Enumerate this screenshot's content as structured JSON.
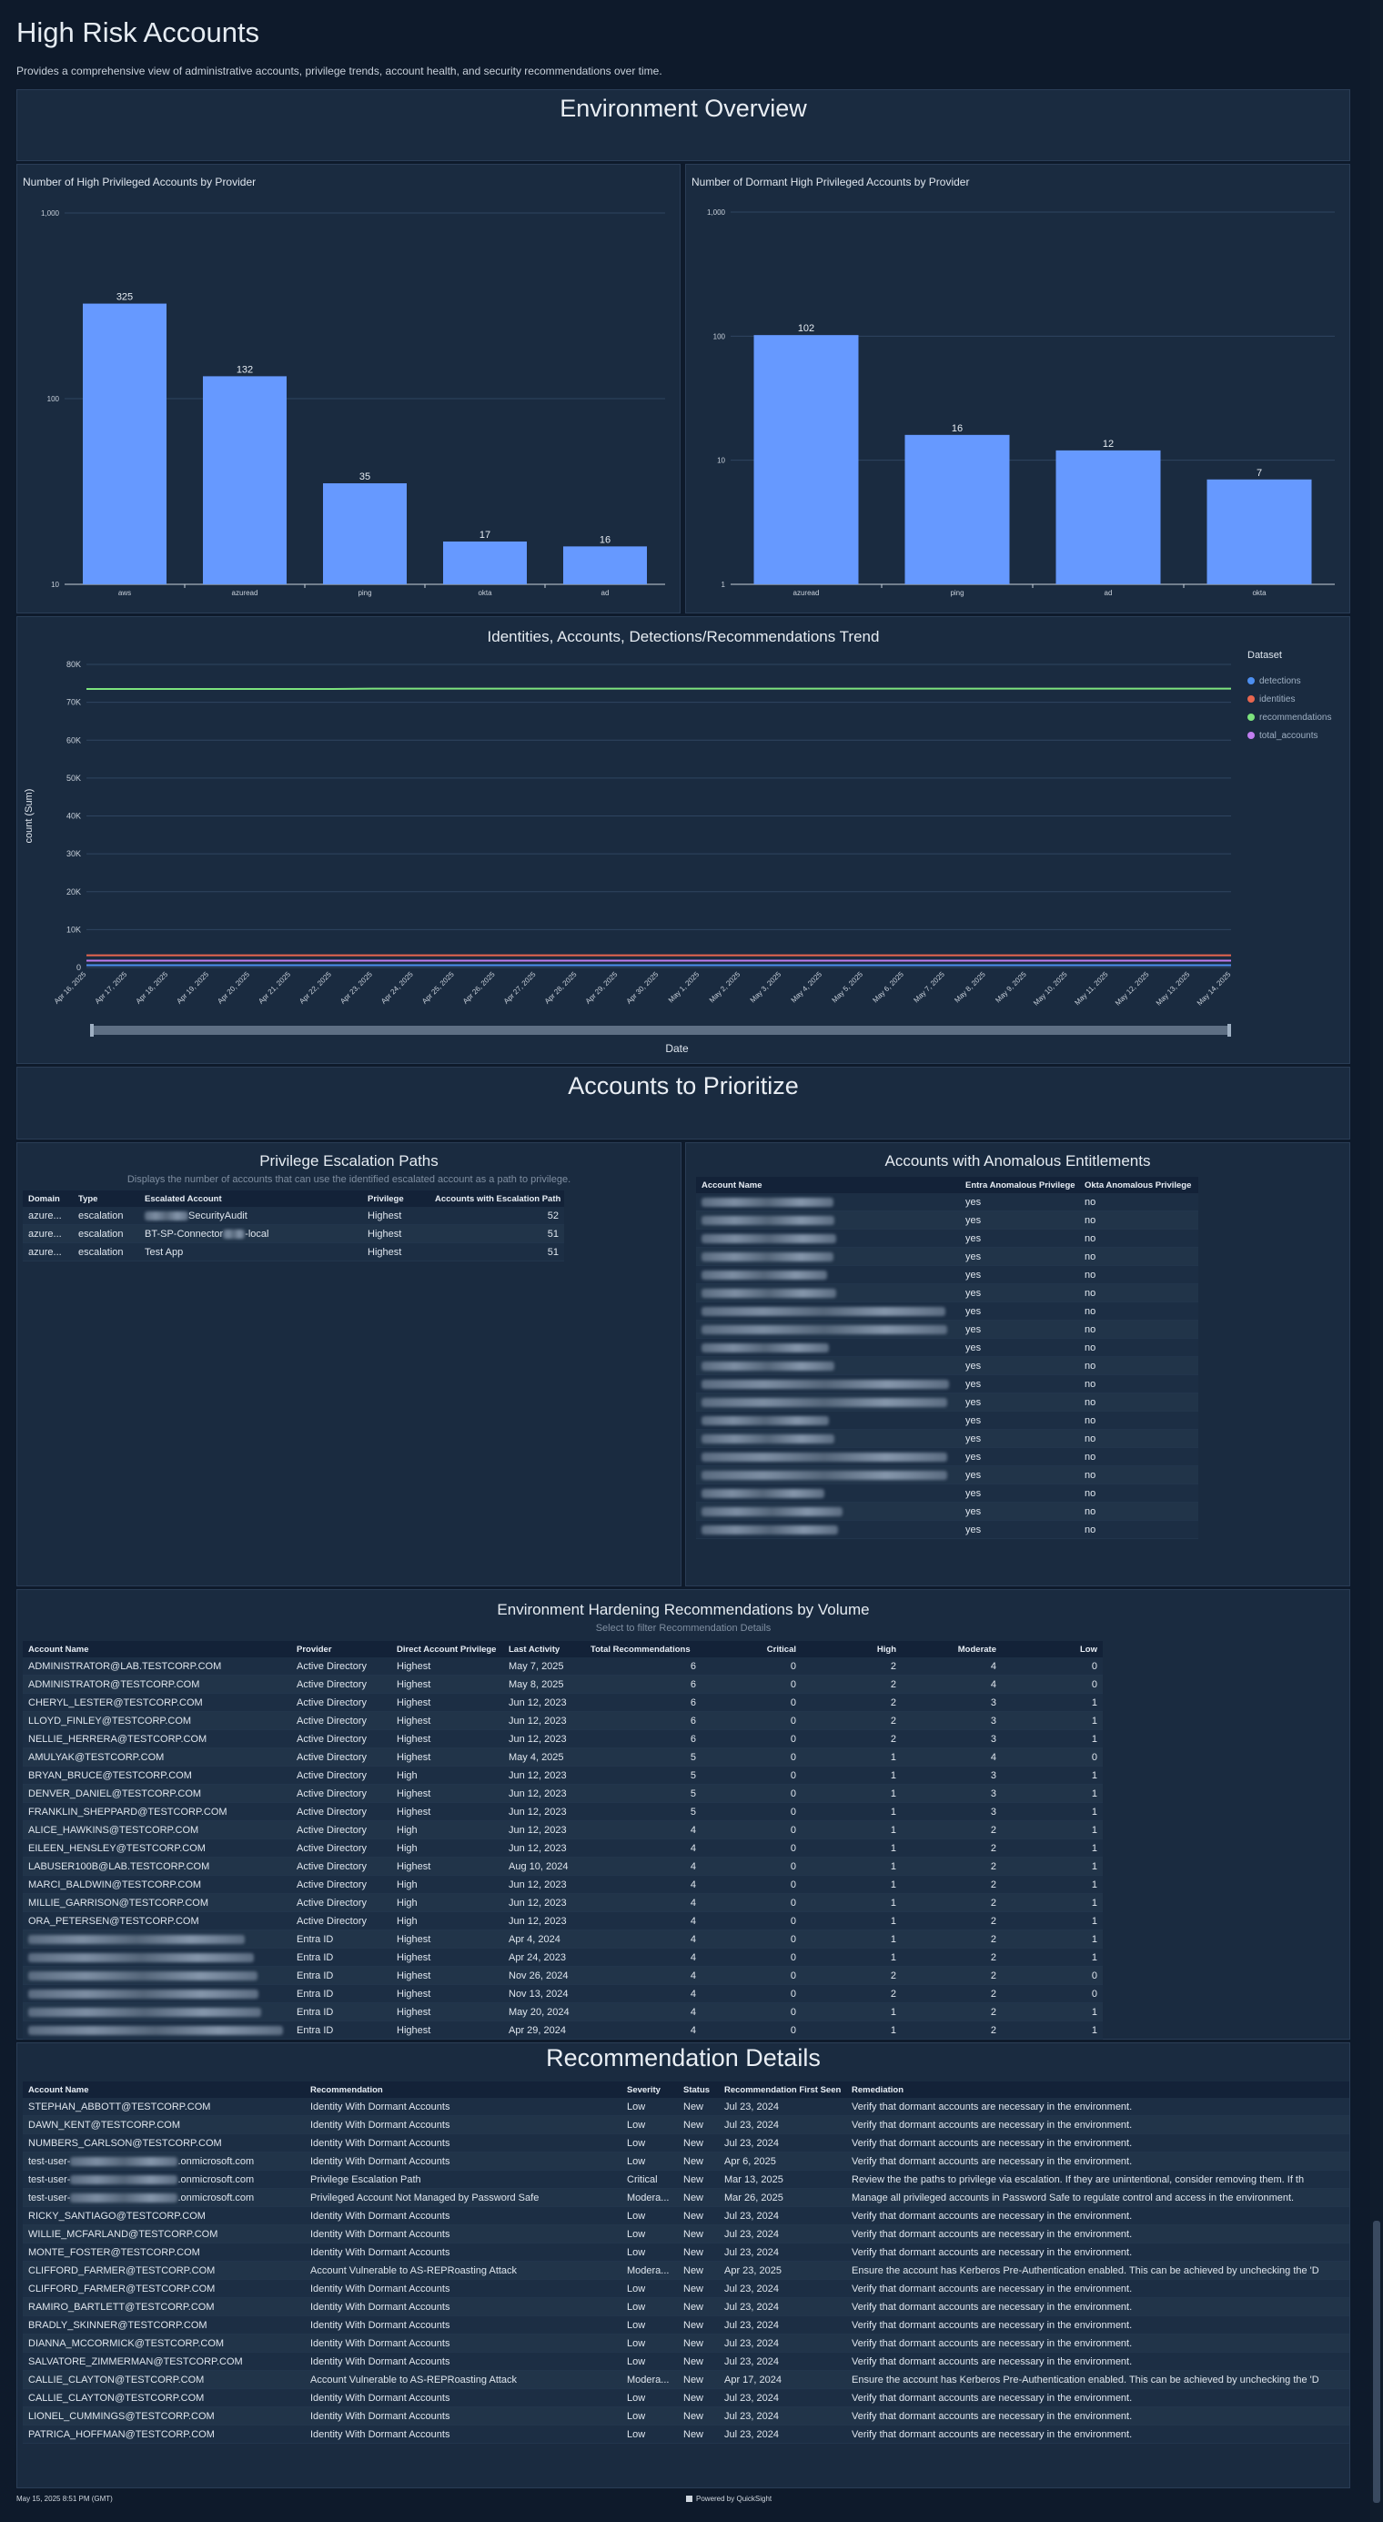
{
  "page": {
    "title": "High Risk Accounts",
    "description": "Provides a comprehensive view of administrative accounts, privilege trends, account health, and security recommendations over time."
  },
  "sections": {
    "env_overview": "Environment Overview",
    "accounts_to_prioritize": "Accounts to Prioritize",
    "recommendation_details": "Recommendation Details"
  },
  "charts": {
    "high_priv": {
      "title": "Number of High Privileged Accounts by Provider"
    },
    "dormant": {
      "title": "Number of Dormant High Privileged Accounts by Provider"
    },
    "trend": {
      "title": "Identities, Accounts, Detections/Recommendations Trend",
      "xlabel": "Date",
      "ylabel": "count (Sum)",
      "legend_title": "Dataset"
    }
  },
  "chart_data": [
    {
      "type": "bar",
      "title": "Number of High Privileged Accounts by Provider",
      "scale": "log",
      "ylim": [
        10,
        1000
      ],
      "yticks": [
        "10",
        "100",
        "1,000"
      ],
      "categories": [
        "aws",
        "azuread",
        "ping",
        "okta",
        "ad"
      ],
      "values": [
        325,
        132,
        35,
        17,
        16
      ],
      "color": "#6699ff"
    },
    {
      "type": "bar",
      "title": "Number of Dormant High Privileged Accounts by Provider",
      "scale": "log",
      "ylim": [
        1,
        1000
      ],
      "yticks": [
        "1",
        "10",
        "100",
        "1,000"
      ],
      "categories": [
        "azuread",
        "ping",
        "ad",
        "okta"
      ],
      "values": [
        102,
        16,
        12,
        7
      ],
      "color": "#6699ff"
    },
    {
      "type": "line",
      "title": "Identities, Accounts, Detections/Recommendations Trend",
      "xlabel": "Date",
      "ylabel": "count (Sum)",
      "ylim": [
        0,
        80000
      ],
      "yticks": [
        "0",
        "10K",
        "20K",
        "30K",
        "40K",
        "50K",
        "60K",
        "70K",
        "80K"
      ],
      "x": [
        "Apr 16, 2025",
        "Apr 17, 2025",
        "Apr 18, 2025",
        "Apr 19, 2025",
        "Apr 20, 2025",
        "Apr 21, 2025",
        "Apr 22, 2025",
        "Apr 23, 2025",
        "Apr 24, 2025",
        "Apr 25, 2025",
        "Apr 26, 2025",
        "Apr 27, 2025",
        "Apr 28, 2025",
        "Apr 29, 2025",
        "Apr 30, 2025",
        "May 1, 2025",
        "May 2, 2025",
        "May 3, 2025",
        "May 4, 2025",
        "May 5, 2025",
        "May 6, 2025",
        "May 7, 2025",
        "May 8, 2025",
        "May 9, 2025",
        "May 10, 2025",
        "May 11, 2025",
        "May 12, 2025",
        "May 13, 2025",
        "May 14, 2025"
      ],
      "series": [
        {
          "name": "detections",
          "color": "#4d8ff0",
          "values": [
            600,
            600,
            600,
            600,
            600,
            600,
            600,
            600,
            600,
            600,
            600,
            600,
            600,
            600,
            600,
            600,
            600,
            600,
            600,
            600,
            600,
            600,
            600,
            600,
            600,
            600,
            600,
            600,
            600
          ]
        },
        {
          "name": "identities",
          "color": "#e8664f",
          "values": [
            3200,
            3200,
            3200,
            3200,
            3200,
            3200,
            3200,
            3200,
            3200,
            3200,
            3200,
            3200,
            3200,
            3200,
            3200,
            3200,
            3200,
            3200,
            3200,
            3200,
            3200,
            3200,
            3200,
            3200,
            3200,
            3200,
            3200,
            3200,
            3200
          ]
        },
        {
          "name": "recommendations",
          "color": "#7de37d",
          "values": [
            73500,
            73500,
            73500,
            73500,
            73500,
            73500,
            73500,
            73600,
            73600,
            73600,
            73600,
            73600,
            73600,
            73600,
            73600,
            73600,
            73600,
            73600,
            73600,
            73600,
            73600,
            73600,
            73600,
            73600,
            73600,
            73600,
            73600,
            73600,
            73600
          ]
        },
        {
          "name": "total_accounts",
          "color": "#c17ef0",
          "values": [
            1800,
            1800,
            1800,
            1800,
            1800,
            1800,
            1800,
            1800,
            1800,
            1800,
            1800,
            1800,
            1800,
            1800,
            1800,
            1800,
            1800,
            1800,
            1800,
            1800,
            1800,
            1800,
            1800,
            1800,
            1800,
            1800,
            1800,
            1800,
            1800
          ]
        }
      ],
      "legend": "right"
    }
  ],
  "escalation": {
    "title": "Privilege Escalation Paths",
    "subtitle": "Displays the number of accounts that can use the identified escalated account as a path to privilege.",
    "headers": [
      "Domain",
      "Type",
      "Escalated Account",
      "Privilege",
      "Accounts with Escalation Path"
    ],
    "rows": [
      {
        "domain": "azure...",
        "type": "escalation",
        "account_suffix": "SecurityAudit",
        "privilege": "Highest",
        "count": "52"
      },
      {
        "domain": "azure...",
        "type": "escalation",
        "account_prefix": "BT-SP-Connector",
        "account_suffix": "-local",
        "privilege": "Highest",
        "count": "51"
      },
      {
        "domain": "azure...",
        "type": "escalation",
        "account": "Test App",
        "privilege": "Highest",
        "count": "51"
      }
    ]
  },
  "anomalous": {
    "title": "Accounts with Anomalous Entitlements",
    "headers": [
      "Account Name",
      "Entra Anomalous Privilege",
      "Okta Anomalous Privilege"
    ],
    "rows": [
      {
        "entra": "yes",
        "okta": "no"
      },
      {
        "entra": "yes",
        "okta": "no"
      },
      {
        "entra": "yes",
        "okta": "no"
      },
      {
        "entra": "yes",
        "okta": "no"
      },
      {
        "entra": "yes",
        "okta": "no"
      },
      {
        "entra": "yes",
        "okta": "no"
      },
      {
        "entra": "yes",
        "okta": "no"
      },
      {
        "entra": "yes",
        "okta": "no"
      },
      {
        "entra": "yes",
        "okta": "no"
      },
      {
        "entra": "yes",
        "okta": "no"
      },
      {
        "entra": "yes",
        "okta": "no"
      },
      {
        "entra": "yes",
        "okta": "no"
      },
      {
        "entra": "yes",
        "okta": "no"
      },
      {
        "entra": "yes",
        "okta": "no"
      },
      {
        "entra": "yes",
        "okta": "no"
      },
      {
        "entra": "yes",
        "okta": "no"
      },
      {
        "entra": "yes",
        "okta": "no"
      },
      {
        "entra": "yes",
        "okta": "no"
      },
      {
        "entra": "yes",
        "okta": "no"
      }
    ]
  },
  "hardening": {
    "title": "Environment Hardening Recommendations by Volume",
    "subtitle": "Select to filter Recommendation Details",
    "headers": [
      "Account Name",
      "Provider",
      "Direct Account Privilege",
      "Last Activity",
      "Total Recommendations",
      "Critical",
      "High",
      "Moderate",
      "Low"
    ],
    "rows": [
      {
        "name": "ADMINISTRATOR@LAB.TESTCORP.COM",
        "provider": "Active Directory",
        "priv": "Highest",
        "last": "May 7, 2025",
        "total": "6",
        "critical": "0",
        "high": "2",
        "moderate": "4",
        "low": "0"
      },
      {
        "name": "ADMINISTRATOR@TESTCORP.COM",
        "provider": "Active Directory",
        "priv": "Highest",
        "last": "May 8, 2025",
        "total": "6",
        "critical": "0",
        "high": "2",
        "moderate": "4",
        "low": "0"
      },
      {
        "name": "CHERYL_LESTER@TESTCORP.COM",
        "provider": "Active Directory",
        "priv": "Highest",
        "last": "Jun 12, 2023",
        "total": "6",
        "critical": "0",
        "high": "2",
        "moderate": "3",
        "low": "1"
      },
      {
        "name": "LLOYD_FINLEY@TESTCORP.COM",
        "provider": "Active Directory",
        "priv": "Highest",
        "last": "Jun 12, 2023",
        "total": "6",
        "critical": "0",
        "high": "2",
        "moderate": "3",
        "low": "1"
      },
      {
        "name": "NELLIE_HERRERA@TESTCORP.COM",
        "provider": "Active Directory",
        "priv": "Highest",
        "last": "Jun 12, 2023",
        "total": "6",
        "critical": "0",
        "high": "2",
        "moderate": "3",
        "low": "1"
      },
      {
        "name": "AMULYAK@TESTCORP.COM",
        "provider": "Active Directory",
        "priv": "Highest",
        "last": "May 4, 2025",
        "total": "5",
        "critical": "0",
        "high": "1",
        "moderate": "4",
        "low": "0"
      },
      {
        "name": "BRYAN_BRUCE@TESTCORP.COM",
        "provider": "Active Directory",
        "priv": "High",
        "last": "Jun 12, 2023",
        "total": "5",
        "critical": "0",
        "high": "1",
        "moderate": "3",
        "low": "1"
      },
      {
        "name": "DENVER_DANIEL@TESTCORP.COM",
        "provider": "Active Directory",
        "priv": "Highest",
        "last": "Jun 12, 2023",
        "total": "5",
        "critical": "0",
        "high": "1",
        "moderate": "3",
        "low": "1"
      },
      {
        "name": "FRANKLIN_SHEPPARD@TESTCORP.COM",
        "provider": "Active Directory",
        "priv": "Highest",
        "last": "Jun 12, 2023",
        "total": "5",
        "critical": "0",
        "high": "1",
        "moderate": "3",
        "low": "1"
      },
      {
        "name": "ALICE_HAWKINS@TESTCORP.COM",
        "provider": "Active Directory",
        "priv": "High",
        "last": "Jun 12, 2023",
        "total": "4",
        "critical": "0",
        "high": "1",
        "moderate": "2",
        "low": "1"
      },
      {
        "name": "EILEEN_HENSLEY@TESTCORP.COM",
        "provider": "Active Directory",
        "priv": "High",
        "last": "Jun 12, 2023",
        "total": "4",
        "critical": "0",
        "high": "1",
        "moderate": "2",
        "low": "1"
      },
      {
        "name": "LABUSER100B@LAB.TESTCORP.COM",
        "provider": "Active Directory",
        "priv": "Highest",
        "last": "Aug 10, 2024",
        "total": "4",
        "critical": "0",
        "high": "1",
        "moderate": "2",
        "low": "1"
      },
      {
        "name": "MARCI_BALDWIN@TESTCORP.COM",
        "provider": "Active Directory",
        "priv": "High",
        "last": "Jun 12, 2023",
        "total": "4",
        "critical": "0",
        "high": "1",
        "moderate": "2",
        "low": "1"
      },
      {
        "name": "MILLIE_GARRISON@TESTCORP.COM",
        "provider": "Active Directory",
        "priv": "High",
        "last": "Jun 12, 2023",
        "total": "4",
        "critical": "0",
        "high": "1",
        "moderate": "2",
        "low": "1"
      },
      {
        "name": "ORA_PETERSEN@TESTCORP.COM",
        "provider": "Active Directory",
        "priv": "High",
        "last": "Jun 12, 2023",
        "total": "4",
        "critical": "0",
        "high": "1",
        "moderate": "2",
        "low": "1"
      },
      {
        "name": "",
        "provider": "Entra ID",
        "priv": "Highest",
        "last": "Apr 4, 2024",
        "total": "4",
        "critical": "0",
        "high": "1",
        "moderate": "2",
        "low": "1"
      },
      {
        "name": "",
        "provider": "Entra ID",
        "priv": "Highest",
        "last": "Apr 24, 2023",
        "total": "4",
        "critical": "0",
        "high": "1",
        "moderate": "2",
        "low": "1"
      },
      {
        "name": "",
        "provider": "Entra ID",
        "priv": "Highest",
        "last": "Nov 26, 2024",
        "total": "4",
        "critical": "0",
        "high": "2",
        "moderate": "2",
        "low": "0"
      },
      {
        "name": "",
        "provider": "Entra ID",
        "priv": "Highest",
        "last": "Nov 13, 2024",
        "total": "4",
        "critical": "0",
        "high": "2",
        "moderate": "2",
        "low": "0"
      },
      {
        "name": "",
        "provider": "Entra ID",
        "priv": "Highest",
        "last": "May 20, 2024",
        "total": "4",
        "critical": "0",
        "high": "1",
        "moderate": "2",
        "low": "1"
      },
      {
        "name": "",
        "provider": "Entra ID",
        "priv": "Highest",
        "last": "Apr 29, 2024",
        "total": "4",
        "critical": "0",
        "high": "1",
        "moderate": "2",
        "low": "1"
      }
    ]
  },
  "details": {
    "headers": [
      "Account Name",
      "Recommendation",
      "Severity",
      "Status",
      "Recommendation First Seen",
      "Remediation"
    ],
    "rows": [
      {
        "name": "STEPHAN_ABBOTT@TESTCORP.COM",
        "rec": "Identity With Dormant Accounts",
        "sev": "Low",
        "status": "New",
        "seen": "Jul 23, 2024",
        "rem": "Verify that dormant accounts are necessary in the environment."
      },
      {
        "name": "DAWN_KENT@TESTCORP.COM",
        "rec": "Identity With Dormant Accounts",
        "sev": "Low",
        "status": "New",
        "seen": "Jul 23, 2024",
        "rem": "Verify that dormant accounts are necessary in the environment."
      },
      {
        "name": "NUMBERS_CARLSON@TESTCORP.COM",
        "rec": "Identity With Dormant Accounts",
        "sev": "Low",
        "status": "New",
        "seen": "Jul 23, 2024",
        "rem": "Verify that dormant accounts are necessary in the environment."
      },
      {
        "name_prefix": "test-user-",
        "name_suffix": ".onmicrosoft.com",
        "rec": "Identity With Dormant Accounts",
        "sev": "Low",
        "status": "New",
        "seen": "Apr 6, 2025",
        "rem": "Verify that dormant accounts are necessary in the environment."
      },
      {
        "name_prefix": "test-user-",
        "name_suffix": ".onmicrosoft.com",
        "rec": "Privilege Escalation Path",
        "sev": "Critical",
        "status": "New",
        "seen": "Mar 13, 2025",
        "rem": "Review the the paths to privilege via escalation.  If they are unintentional, consider removing them.  If th"
      },
      {
        "name_prefix": "test-user-",
        "name_suffix": ".onmicrosoft.com",
        "rec": "Privileged Account Not Managed by Password Safe",
        "sev": "Modera...",
        "status": "New",
        "seen": "Mar 26, 2025",
        "rem": "Manage all privileged accounts in Password Safe to regulate control and access in the environment."
      },
      {
        "name": "RICKY_SANTIAGO@TESTCORP.COM",
        "rec": "Identity With Dormant Accounts",
        "sev": "Low",
        "status": "New",
        "seen": "Jul 23, 2024",
        "rem": "Verify that dormant accounts are necessary in the environment."
      },
      {
        "name": "WILLIE_MCFARLAND@TESTCORP.COM",
        "rec": "Identity With Dormant Accounts",
        "sev": "Low",
        "status": "New",
        "seen": "Jul 23, 2024",
        "rem": "Verify that dormant accounts are necessary in the environment."
      },
      {
        "name": "MONTE_FOSTER@TESTCORP.COM",
        "rec": "Identity With Dormant Accounts",
        "sev": "Low",
        "status": "New",
        "seen": "Jul 23, 2024",
        "rem": "Verify that dormant accounts are necessary in the environment."
      },
      {
        "name": "CLIFFORD_FARMER@TESTCORP.COM",
        "rec": "Account Vulnerable to AS-REPRoasting Attack",
        "sev": "Modera...",
        "status": "New",
        "seen": "Apr 23, 2025",
        "rem": "Ensure the account has Kerberos Pre-Authentication enabled. This can be achieved by unchecking the 'D"
      },
      {
        "name": "CLIFFORD_FARMER@TESTCORP.COM",
        "rec": "Identity With Dormant Accounts",
        "sev": "Low",
        "status": "New",
        "seen": "Jul 23, 2024",
        "rem": "Verify that dormant accounts are necessary in the environment."
      },
      {
        "name": "RAMIRO_BARTLETT@TESTCORP.COM",
        "rec": "Identity With Dormant Accounts",
        "sev": "Low",
        "status": "New",
        "seen": "Jul 23, 2024",
        "rem": "Verify that dormant accounts are necessary in the environment."
      },
      {
        "name": "BRADLY_SKINNER@TESTCORP.COM",
        "rec": "Identity With Dormant Accounts",
        "sev": "Low",
        "status": "New",
        "seen": "Jul 23, 2024",
        "rem": "Verify that dormant accounts are necessary in the environment."
      },
      {
        "name": "DIANNA_MCCORMICK@TESTCORP.COM",
        "rec": "Identity With Dormant Accounts",
        "sev": "Low",
        "status": "New",
        "seen": "Jul 23, 2024",
        "rem": "Verify that dormant accounts are necessary in the environment."
      },
      {
        "name": "SALVATORE_ZIMMERMAN@TESTCORP.COM",
        "rec": "Identity With Dormant Accounts",
        "sev": "Low",
        "status": "New",
        "seen": "Jul 23, 2024",
        "rem": "Verify that dormant accounts are necessary in the environment."
      },
      {
        "name": "CALLIE_CLAYTON@TESTCORP.COM",
        "rec": "Account Vulnerable to AS-REPRoasting Attack",
        "sev": "Modera...",
        "status": "New",
        "seen": "Apr 17, 2024",
        "rem": "Ensure the account has Kerberos Pre-Authentication enabled. This can be achieved by unchecking the 'D"
      },
      {
        "name": "CALLIE_CLAYTON@TESTCORP.COM",
        "rec": "Identity With Dormant Accounts",
        "sev": "Low",
        "status": "New",
        "seen": "Jul 23, 2024",
        "rem": "Verify that dormant accounts are necessary in the environment."
      },
      {
        "name": "LIONEL_CUMMINGS@TESTCORP.COM",
        "rec": "Identity With Dormant Accounts",
        "sev": "Low",
        "status": "New",
        "seen": "Jul 23, 2024",
        "rem": "Verify that dormant accounts are necessary in the environment."
      },
      {
        "name": "PATRICA_HOFFMAN@TESTCORP.COM",
        "rec": "Identity With Dormant Accounts",
        "sev": "Low",
        "status": "New",
        "seen": "Jul 23, 2024",
        "rem": "Verify that dormant accounts are necessary in the environment."
      }
    ]
  },
  "footer": {
    "timestamp": "May 15, 2025 8:51 PM (GMT)",
    "powered_by": "Powered by QuickSight"
  }
}
